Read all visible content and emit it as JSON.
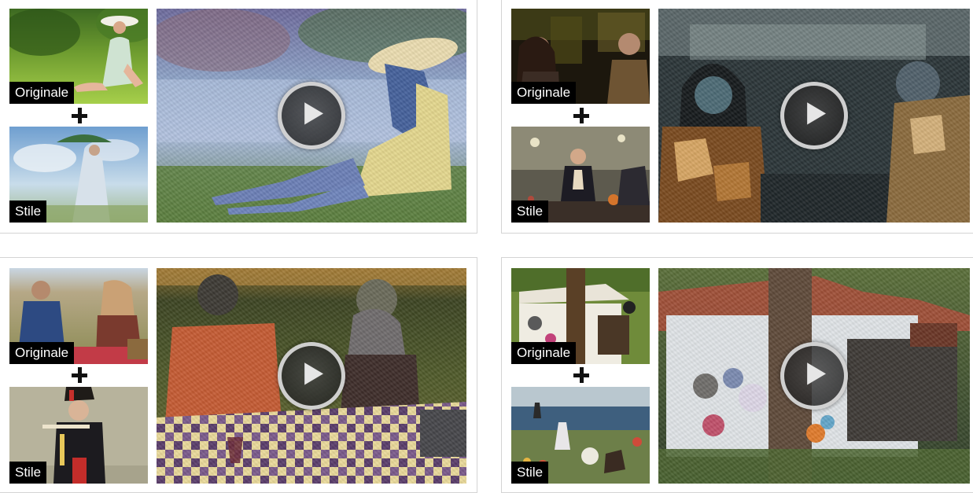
{
  "labels": {
    "original": "Originale",
    "style": "Stile"
  },
  "cards": [
    {
      "id": "woman-hat",
      "original_label": "Originale",
      "style_label": "Stile",
      "play_icon": "play-icon"
    },
    {
      "id": "bar",
      "original_label": "Originale",
      "style_label": "Stile",
      "play_icon": "play-icon"
    },
    {
      "id": "picnic",
      "original_label": "Originale",
      "style_label": "Stile",
      "play_icon": "play-icon"
    },
    {
      "id": "house",
      "original_label": "Originale",
      "style_label": "Stile",
      "play_icon": "play-icon"
    }
  ]
}
